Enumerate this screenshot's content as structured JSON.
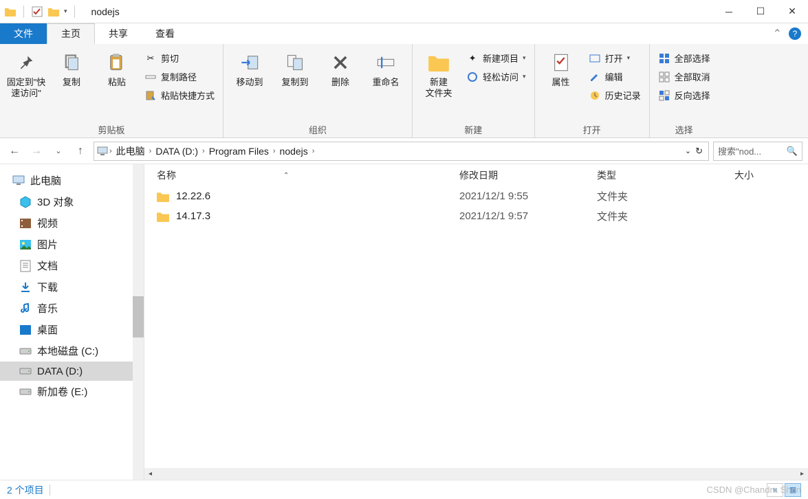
{
  "title": "nodejs",
  "tabs": {
    "file": "文件",
    "home": "主页",
    "share": "共享",
    "view": "查看"
  },
  "ribbon": {
    "clipboard": {
      "label": "剪贴板",
      "pin": "固定到\"快\n速访问\"",
      "copy": "复制",
      "paste": "粘贴",
      "cut": "剪切",
      "copypath": "复制路径",
      "pasteshort": "粘贴快捷方式"
    },
    "organize": {
      "label": "组织",
      "moveto": "移动到",
      "copyto": "复制到",
      "delete": "删除",
      "rename": "重命名"
    },
    "new": {
      "label": "新建",
      "newfolder": "新建\n文件夹",
      "newitem": "新建项目",
      "easyaccess": "轻松访问"
    },
    "open": {
      "label": "打开",
      "properties": "属性",
      "open": "打开",
      "edit": "编辑",
      "history": "历史记录"
    },
    "select": {
      "label": "选择",
      "all": "全部选择",
      "none": "全部取消",
      "invert": "反向选择"
    }
  },
  "breadcrumb": [
    "此电脑",
    "DATA (D:)",
    "Program Files",
    "nodejs"
  ],
  "search_placeholder": "搜索\"nod...",
  "tree": [
    {
      "icon": "pc",
      "label": "此电脑",
      "root": true
    },
    {
      "icon": "cube",
      "label": "3D 对象"
    },
    {
      "icon": "video",
      "label": "视频"
    },
    {
      "icon": "pictures",
      "label": "图片"
    },
    {
      "icon": "docs",
      "label": "文档"
    },
    {
      "icon": "download",
      "label": "下载"
    },
    {
      "icon": "music",
      "label": "音乐"
    },
    {
      "icon": "desktop",
      "label": "桌面"
    },
    {
      "icon": "disk",
      "label": "本地磁盘 (C:)"
    },
    {
      "icon": "disk",
      "label": "DATA (D:)",
      "sel": true
    },
    {
      "icon": "disk",
      "label": "新加卷 (E:)"
    }
  ],
  "columns": {
    "name": "名称",
    "date": "修改日期",
    "type": "类型",
    "size": "大小"
  },
  "rows": [
    {
      "name": "12.22.6",
      "date": "2021/12/1 9:55",
      "type": "文件夹"
    },
    {
      "name": "14.17.3",
      "date": "2021/12/1 9:57",
      "type": "文件夹"
    }
  ],
  "status": "2 个项目",
  "watermark": "CSDN @Chandra Shen"
}
